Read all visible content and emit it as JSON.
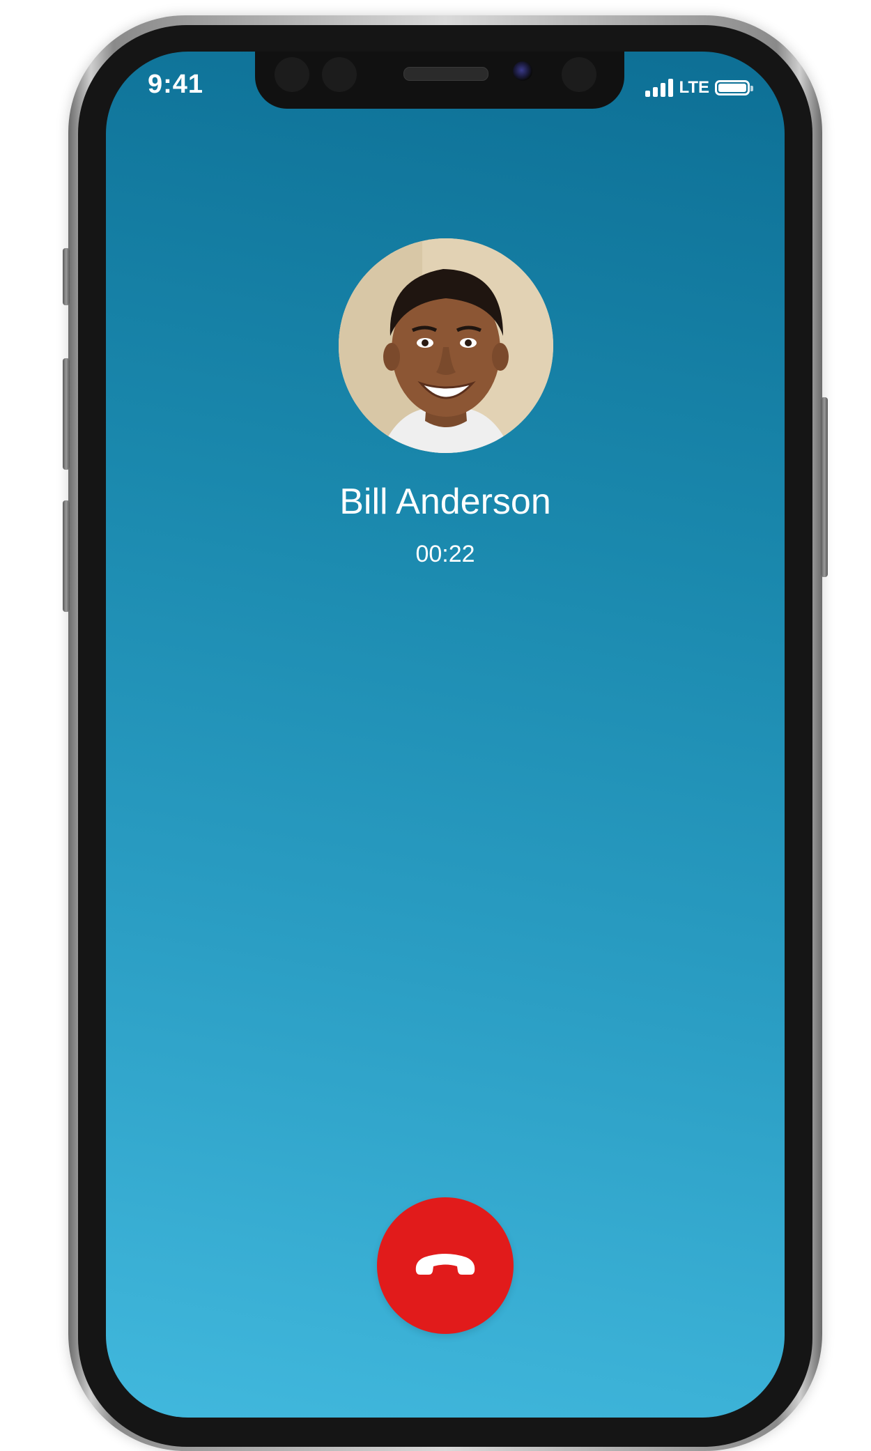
{
  "status_bar": {
    "time": "9:41",
    "network": "LTE",
    "battery_level": 1.0
  },
  "call": {
    "contact_name": "Bill Anderson",
    "duration": "00:22"
  },
  "icons": {
    "end_call": "phone-hangup-icon",
    "signal": "signal-bars-icon",
    "battery": "battery-icon"
  },
  "colors": {
    "end_call_button": "#e11b1b",
    "background_top": "#0d6f95",
    "background_bottom": "#41b8dd",
    "text": "#ffffff"
  }
}
